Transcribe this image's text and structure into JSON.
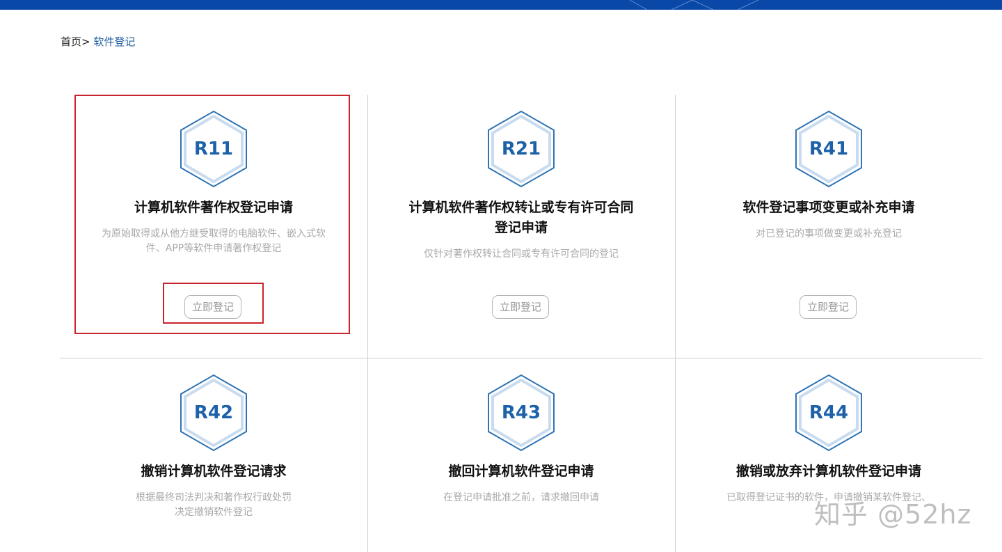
{
  "breadcrumb": {
    "home": "首页>",
    "current": "软件登记"
  },
  "action_label": "立即登记",
  "cards": [
    {
      "code": "R11",
      "title": "计算机软件著作权登记申请",
      "desc": "为原始取得或从他方继受取得的电脑软件、嵌入式软件、APP等软件申请著作权登记"
    },
    {
      "code": "R21",
      "title": "计算机软件著作权转让或专有许可合同登记申请",
      "desc": "仅针对著作权转让合同或专有许可合同的登记"
    },
    {
      "code": "R41",
      "title": "软件登记事项变更或补充申请",
      "desc": "对已登记的事项做变更或补充登记"
    },
    {
      "code": "R42",
      "title": "撤销计算机软件登记请求",
      "desc": "根据最终司法判决和著作权行政处罚决定撤销软件登记"
    },
    {
      "code": "R43",
      "title": "撤回计算机软件登记申请",
      "desc": "在登记申请批准之前，请求撤回申请"
    },
    {
      "code": "R44",
      "title": "撤销或放弃计算机软件登记申请",
      "desc": "已取得登记证书的软件，申请撤销某软件登记、"
    }
  ],
  "watermark": "知乎 @52hz",
  "colors": {
    "header": "#0a48a8",
    "hex_code": "#1d62a8",
    "highlight": "#c8242b"
  }
}
